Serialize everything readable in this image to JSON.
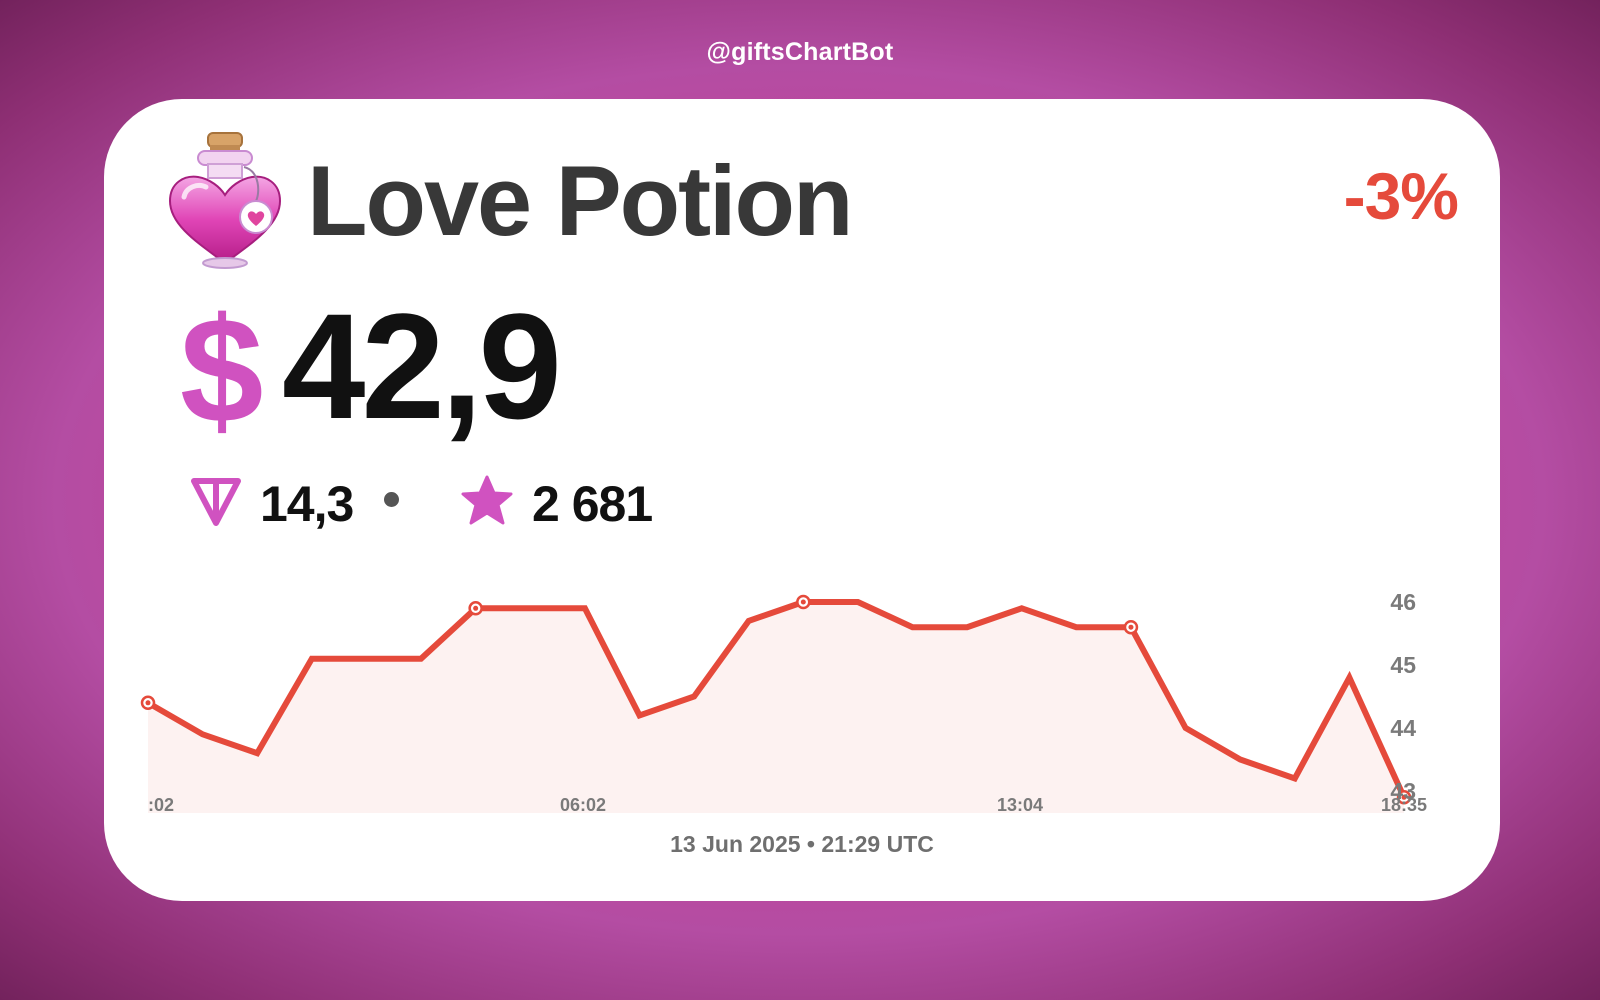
{
  "handle": "@giftsChartBot",
  "gift": {
    "name": "Love Potion",
    "change": "-3%",
    "price_usd_symbol": "$",
    "price_usd": "42,9",
    "price_ton": "14,3",
    "price_stars": "2 681",
    "icons": {
      "gift": "love-potion-bottle",
      "ton": "ton-icon",
      "stars": "star-icon"
    }
  },
  "colors": {
    "accent": "#d052c0",
    "negative": "#e54a3b",
    "line": "#e54a3b",
    "fill": "#fdf2f1"
  },
  "timestamp": "13 Jun 2025 • 21:29 UTC",
  "chart_data": {
    "type": "line",
    "title": "",
    "xlabel": "",
    "ylabel": "",
    "x_tick_labels": [
      ":02",
      "06:02",
      "13:04",
      "18:35"
    ],
    "y_ticks": [
      43,
      44,
      45,
      46
    ],
    "ylim": [
      42.7,
      46.0
    ],
    "grid": false,
    "legend": "none",
    "series": [
      {
        "values": [
          44.4,
          43.9,
          43.6,
          45.1,
          45.1,
          45.1,
          45.9,
          45.9,
          45.9,
          44.2,
          44.5,
          45.7,
          46.0,
          46.0,
          45.6,
          45.6,
          45.9,
          45.6,
          45.6,
          44.0,
          43.5,
          43.2,
          44.8,
          42.9
        ],
        "markers": [
          0,
          6,
          12,
          18,
          23
        ]
      }
    ]
  }
}
